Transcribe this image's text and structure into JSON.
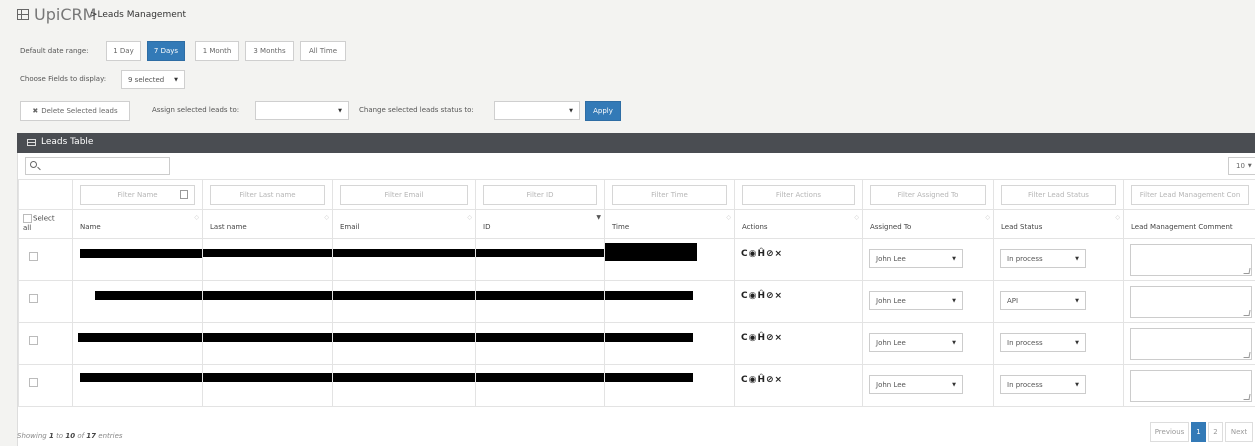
{
  "header": {
    "brand": "UpiCRM",
    "breadcrumb": ">Leads Management"
  },
  "date_range": {
    "label": "Default date range:",
    "options": [
      "1 Day",
      "7 Days",
      "1 Month",
      "3 Months",
      "All Time"
    ],
    "selected": "7 Days"
  },
  "fields": {
    "label": "Choose Fields to display:",
    "value": "9 selected"
  },
  "bulk": {
    "delete_label": "Delete Selected leads",
    "assign_label": "Assign selected leads to:",
    "assign_value": "",
    "status_label": "Change selected leads status to:",
    "status_value": "",
    "apply_label": "Apply"
  },
  "table": {
    "title": "Leads Table",
    "search_value": "",
    "page_length": "10",
    "filters": [
      "Filter Name",
      "Filter Last name",
      "Filter Email",
      "Filter ID",
      "Filter Time",
      "Filter Actions",
      "Filter Assigned To",
      "Filter Lead Status",
      "Filter Lead Management Con"
    ],
    "select_all_label_1": "Select",
    "select_all_label_2": "all",
    "columns": [
      "Name",
      "Last name",
      "Email",
      "ID",
      "Time",
      "Actions",
      "Assigned To",
      "Lead Status",
      "Lead Management Comment"
    ],
    "action_glyphs": "C◉Ĥ⊘×",
    "rows": [
      {
        "assigned_to": "John Lee",
        "lead_status": "In process",
        "comment": ""
      },
      {
        "assigned_to": "John Lee",
        "lead_status": "API",
        "comment": ""
      },
      {
        "assigned_to": "John Lee",
        "lead_status": "In process",
        "comment": ""
      },
      {
        "assigned_to": "John Lee",
        "lead_status": "In process",
        "comment": ""
      }
    ]
  },
  "footer": {
    "info_prefix": "Showing",
    "from": "1",
    "to_word": "to",
    "to": "10",
    "of_word": "of",
    "total": "17",
    "suffix": "entries",
    "prev": "Previous",
    "pages": [
      "1",
      "2"
    ],
    "current_page": "1",
    "next": "Next"
  },
  "colors": {
    "accent": "#337ab7",
    "panel_header": "#4a4d52",
    "background": "#f3f3f1"
  }
}
